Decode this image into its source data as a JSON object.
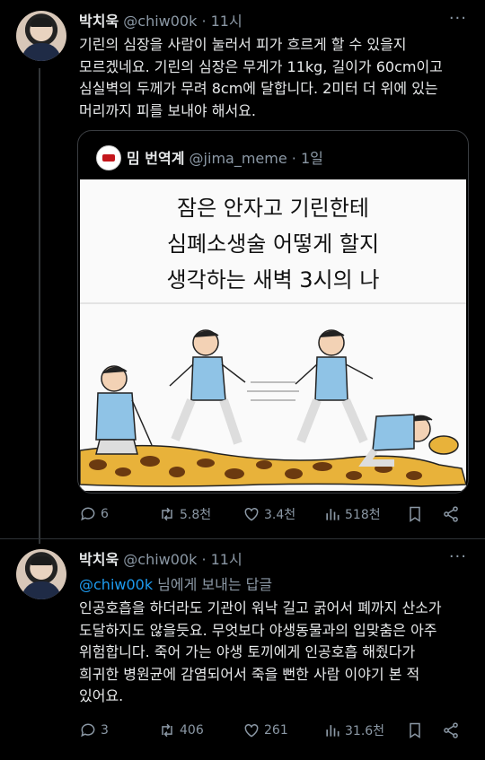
{
  "tweet1": {
    "name": "박치욱",
    "handle": "@chiw00k",
    "time": "· 11시",
    "more": "···",
    "text": "기린의 심장을 사람이 눌러서 피가 흐르게 할 수 있을지\n모르겠네요. 기린의 심장은 무게가 11kg, 길이가 60cm이고\n심실벽의 두께가 무려 8cm에 달합니다. 2미터 더 위에 있는\n머리까지 피를 보내야 해서요.",
    "quote": {
      "name": "밈 번역계",
      "handle": "@jima_meme",
      "time": "· 1일",
      "comic_lines": [
        "잠은 안자고 기린한테",
        "심폐소생술 어떻게 할지",
        "생각하는 새벽 3시의 나"
      ]
    },
    "actions": {
      "replies": "6",
      "retweets": "5.8천",
      "likes": "3.4천",
      "views": "518천"
    }
  },
  "tweet2": {
    "name": "박치욱",
    "handle": "@chiw00k",
    "time": "· 11시",
    "more": "···",
    "reply_mention": "@chiw00k",
    "reply_rest": " 님에게 보내는 답글",
    "text": "인공호흡을 하더라도 기관이 워낙 길고 굵어서  폐까지 산소가\n도달하지도 않을듯요. 무엇보다 야생동물과의 입맞춤은 아주\n위험합니다. 죽어 가는 야생 토끼에게 인공호흡 해줬다가\n희귀한 병원균에 감염되어서 죽을 뻔한 사람 이야기 본 적\n있어요.",
    "actions": {
      "replies": "3",
      "retweets": "406",
      "likes": "261",
      "views": "31.6천"
    }
  },
  "colors": {
    "accent": "#1d9bf0",
    "muted": "#8b98a5",
    "text": "#e7e9ea",
    "giraffe": "#e8b23a"
  }
}
